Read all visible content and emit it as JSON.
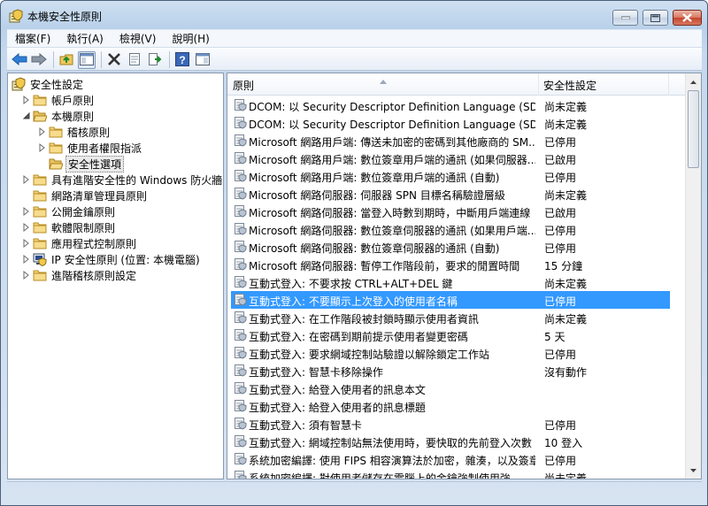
{
  "window": {
    "title": "本機安全性原則"
  },
  "menu": [
    "檔案(F)",
    "執行(A)",
    "檢視(V)",
    "說明(H)"
  ],
  "tree": [
    {
      "label": "安全性設定",
      "level": 0,
      "twisty": "none",
      "icon": "shield-icon"
    },
    {
      "label": "帳戶原則",
      "level": 1,
      "twisty": "collapsed",
      "icon": "folder-icon"
    },
    {
      "label": "本機原則",
      "level": 1,
      "twisty": "expanded",
      "icon": "folder-open-icon"
    },
    {
      "label": "稽核原則",
      "level": 2,
      "twisty": "collapsed",
      "icon": "folder-icon"
    },
    {
      "label": "使用者權限指派",
      "level": 2,
      "twisty": "collapsed",
      "icon": "folder-icon"
    },
    {
      "label": "安全性選項",
      "level": 2,
      "twisty": "none",
      "icon": "folder-open-icon",
      "selected": true
    },
    {
      "label": "具有進階安全性的 Windows 防火牆",
      "level": 1,
      "twisty": "collapsed",
      "icon": "folder-icon"
    },
    {
      "label": "網路清單管理員原則",
      "level": 1,
      "twisty": "none",
      "icon": "folder-icon"
    },
    {
      "label": "公開金鑰原則",
      "level": 1,
      "twisty": "collapsed",
      "icon": "folder-icon"
    },
    {
      "label": "軟體限制原則",
      "level": 1,
      "twisty": "collapsed",
      "icon": "folder-icon"
    },
    {
      "label": "應用程式控制原則",
      "level": 1,
      "twisty": "collapsed",
      "icon": "folder-icon"
    },
    {
      "label": "IP 安全性原則 (位置: 本機電腦)",
      "level": 1,
      "twisty": "collapsed",
      "icon": "ip-security-icon"
    },
    {
      "label": "進階稽核原則設定",
      "level": 1,
      "twisty": "collapsed",
      "icon": "folder-icon"
    }
  ],
  "list": {
    "headers": {
      "policy": "原則",
      "setting": "安全性設定"
    },
    "rows": [
      {
        "policy": "DCOM: 以 Security Descriptor Definition Language (SDD...",
        "setting": "尚未定義"
      },
      {
        "policy": "DCOM: 以 Security Descriptor Definition Language (SDD...",
        "setting": "尚未定義"
      },
      {
        "policy": "Microsoft 網路用戶端: 傳送未加密的密碼到其他廠商的 SM...",
        "setting": "已停用"
      },
      {
        "policy": "Microsoft 網路用戶端: 數位簽章用戶端的通訊 (如果伺服器...",
        "setting": "已啟用"
      },
      {
        "policy": "Microsoft 網路用戶端: 數位簽章用戶端的通訊 (自動)",
        "setting": "已停用"
      },
      {
        "policy": "Microsoft 網路伺服器: 伺服器 SPN 目標名稱驗證層級",
        "setting": "尚未定義"
      },
      {
        "policy": "Microsoft 網路伺服器: 當登入時數到期時，中斷用戶端連線",
        "setting": "已啟用"
      },
      {
        "policy": "Microsoft 網路伺服器: 數位簽章伺服器的通訊 (如果用戶端...",
        "setting": "已停用"
      },
      {
        "policy": "Microsoft 網路伺服器: 數位簽章伺服器的通訊 (自動)",
        "setting": "已停用"
      },
      {
        "policy": "Microsoft 網路伺服器: 暫停工作階段前，要求的閒置時間",
        "setting": "15 分鐘"
      },
      {
        "policy": "互動式登入: 不要求按 CTRL+ALT+DEL 鍵",
        "setting": "尚未定義"
      },
      {
        "policy": "互動式登入: 不要顯示上次登入的使用者名稱",
        "setting": "已停用",
        "selected": true
      },
      {
        "policy": "互動式登入: 在工作階段被封鎖時顯示使用者資訊",
        "setting": "尚未定義"
      },
      {
        "policy": "互動式登入: 在密碼到期前提示使用者變更密碼",
        "setting": "5 天"
      },
      {
        "policy": "互動式登入: 要求網域控制站驗證以解除鎖定工作站",
        "setting": "已停用"
      },
      {
        "policy": "互動式登入: 智慧卡移除操作",
        "setting": "沒有動作"
      },
      {
        "policy": "互動式登入: 給登入使用者的訊息本文",
        "setting": ""
      },
      {
        "policy": "互動式登入: 給登入使用者的訊息標題",
        "setting": ""
      },
      {
        "policy": "互動式登入: 須有智慧卡",
        "setting": "已停用"
      },
      {
        "policy": "互動式登入: 網域控制站無法使用時，要快取的先前登入次數",
        "setting": "10 登入"
      },
      {
        "policy": "系統加密編譯: 使用 FIPS 相容演算法於加密，雜湊，以及簽章",
        "setting": "已停用"
      },
      {
        "policy": "系統加密編譯: 對使用者儲存在電腦上的金鑰強制使用強",
        "setting": "尚未定義"
      }
    ]
  },
  "colors": {
    "selection": "#3399ff",
    "tree_selection": "#eaeaea"
  }
}
